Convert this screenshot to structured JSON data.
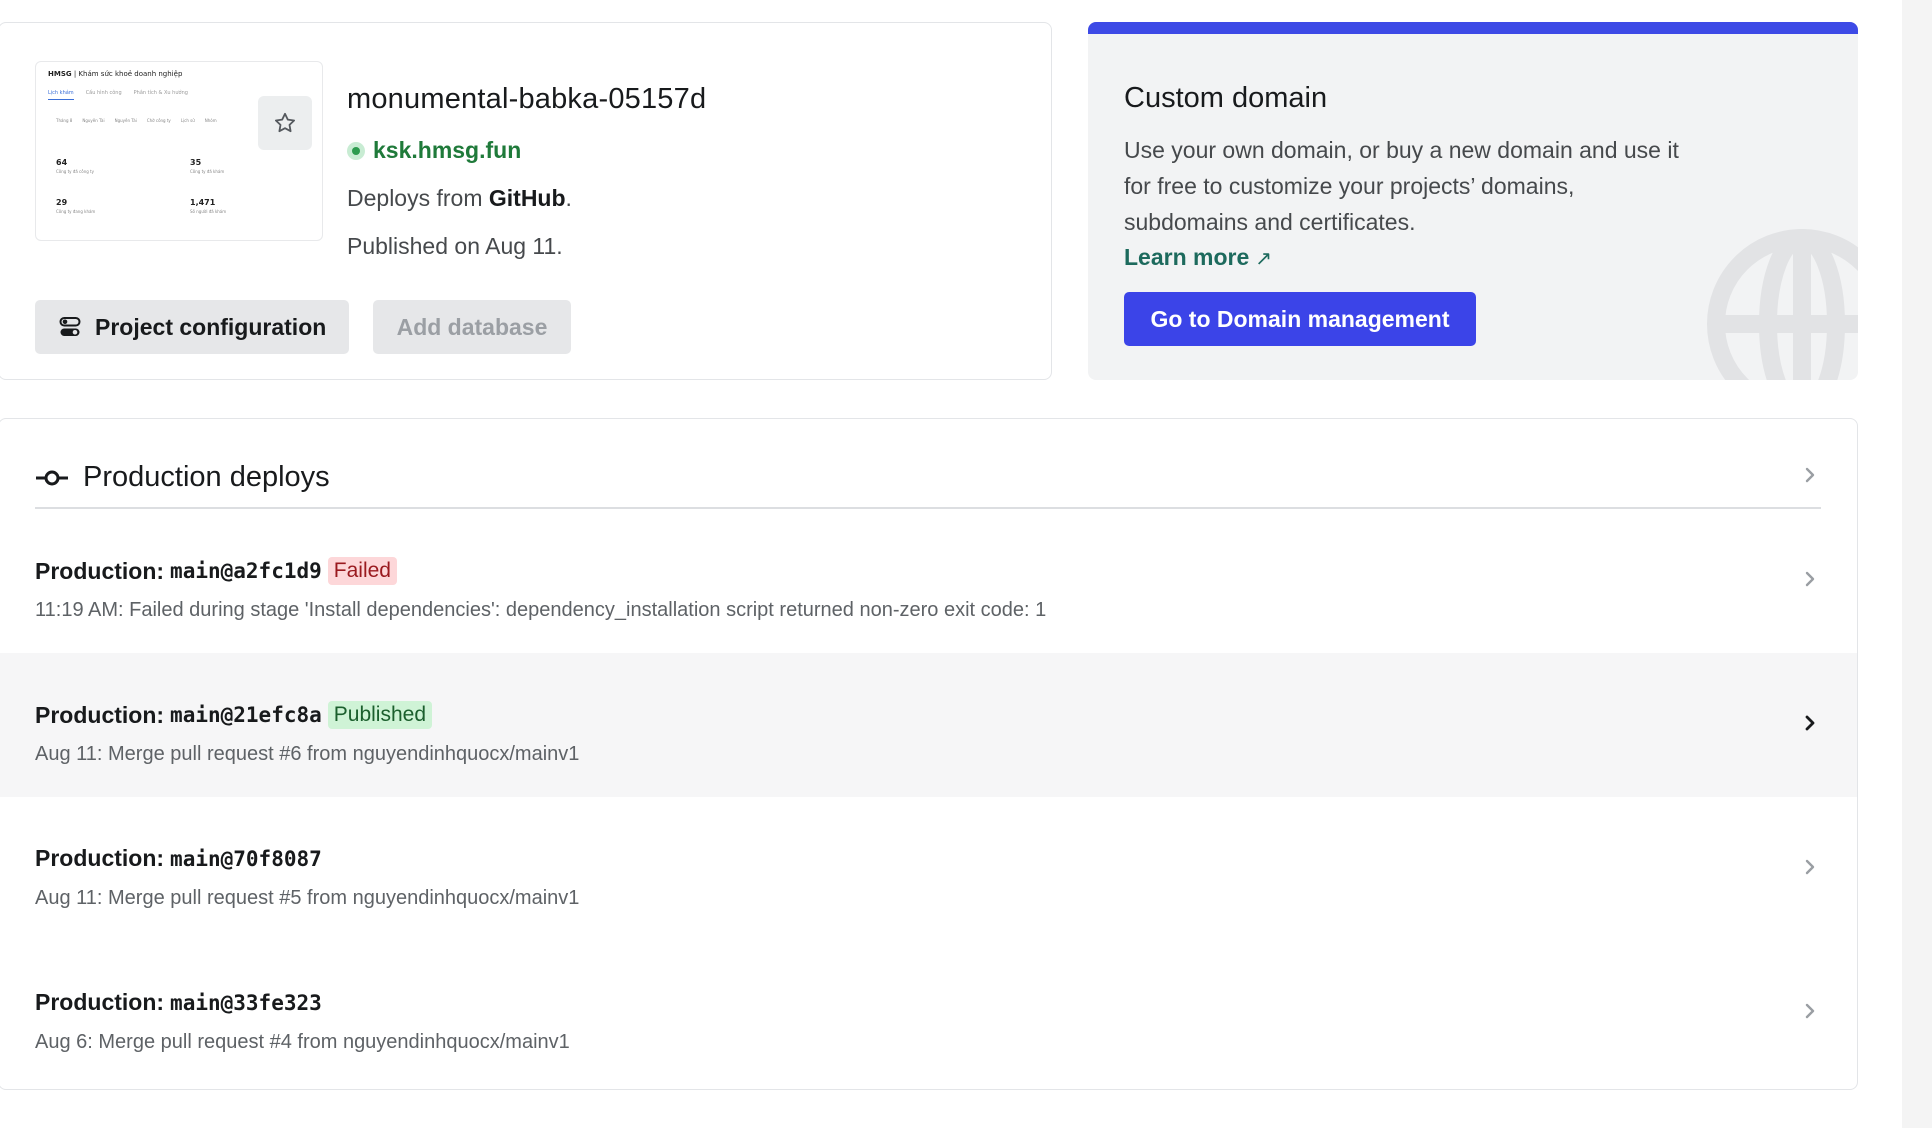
{
  "site": {
    "name": "monumental-babka-05157d",
    "url": "ksk.hmsg.fun",
    "deploys_from_prefix": "Deploys from ",
    "deploys_from_source": "GitHub",
    "deploys_from_suffix": ".",
    "published_on": "Published on Aug 11.",
    "thumbnail": {
      "title_brand": "HMSG",
      "title_rest": " | Khám sức khoẻ doanh nghiệp",
      "tabs": [
        "Lịch khám",
        "Cấu hình công",
        "Phân tích & Xu hướng"
      ],
      "row": [
        "Tháng 8",
        "Nguyên Tài",
        "Nguyên Tài",
        "Chờ công ty",
        "Lịch sử",
        "Nhóm"
      ],
      "stats": [
        {
          "value": "64",
          "label": "Công ty đã công ty"
        },
        {
          "value": "35",
          "label": "Công ty đã khám"
        },
        {
          "value": "29",
          "label": "Công ty đang khám"
        },
        {
          "value": "1,471",
          "label": "Số người đã khám"
        }
      ]
    },
    "buttons": {
      "project_configuration": "Project configuration",
      "add_database": "Add database"
    }
  },
  "custom_domain": {
    "title": "Custom domain",
    "description": "Use your own domain, or buy a new domain and use it for free to customize your projects’ domains, subdomains and certificates.",
    "learn_more": "Learn more",
    "learn_more_arrow": "↗",
    "button": "Go to Domain management",
    "accent_color": "#3d4ae6"
  },
  "production_deploys": {
    "title": "Production deploys",
    "items": [
      {
        "label": "Production: ",
        "ref": "main@a2fc1d9",
        "status": "Failed",
        "message": "11:19 AM: Failed during stage 'Install dependencies': dependency_installation script returned non-zero exit code: 1"
      },
      {
        "label": "Production: ",
        "ref": "main@21efc8a",
        "status": "Published",
        "message": "Aug 11: Merge pull request #6 from nguyendinhquocx/mainv1"
      },
      {
        "label": "Production: ",
        "ref": "main@70f8087",
        "status": "",
        "message": "Aug 11: Merge pull request #5 from nguyendinhquocx/mainv1"
      },
      {
        "label": "Production: ",
        "ref": "main@33fe323",
        "status": "",
        "message": "Aug 6: Merge pull request #4 from nguyendinhquocx/mainv1"
      }
    ]
  },
  "colors": {
    "failed_bg": "#fdd7d9",
    "failed_text": "#9a1a1f",
    "published_bg": "#cff3d6",
    "published_text": "#1b5f2d",
    "link_green": "#1f7a3a",
    "primary_button": "#3b44e8"
  }
}
